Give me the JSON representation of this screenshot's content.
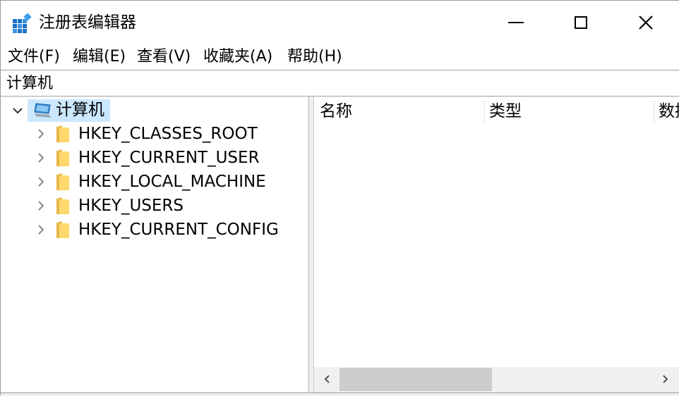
{
  "window": {
    "title": "注册表编辑器",
    "icon": "registry-editor-icon",
    "controls": {
      "minimize": "minimize-icon",
      "maximize": "maximize-icon",
      "close": "close-icon"
    }
  },
  "menu": {
    "items": [
      "文件(F)",
      "编辑(E)",
      "查看(V)",
      "收藏夹(A)",
      "帮助(H)"
    ]
  },
  "address": {
    "path": "计算机"
  },
  "tree": {
    "root": {
      "label": "计算机",
      "expanded": true,
      "selected": true,
      "icon": "computer-icon"
    },
    "children": [
      {
        "label": "HKEY_CLASSES_ROOT",
        "icon": "folder-icon"
      },
      {
        "label": "HKEY_CURRENT_USER",
        "icon": "folder-icon"
      },
      {
        "label": "HKEY_LOCAL_MACHINE",
        "icon": "folder-icon"
      },
      {
        "label": "HKEY_USERS",
        "icon": "folder-icon"
      },
      {
        "label": "HKEY_CURRENT_CONFIG",
        "icon": "folder-icon"
      }
    ]
  },
  "list": {
    "columns": [
      "名称",
      "类型",
      "数据"
    ]
  },
  "colors": {
    "selection": "#cce8ff",
    "folder": "#ffd86b",
    "scrollbar_track": "#f0f0f0",
    "scrollbar_thumb": "#cdcdcd"
  }
}
